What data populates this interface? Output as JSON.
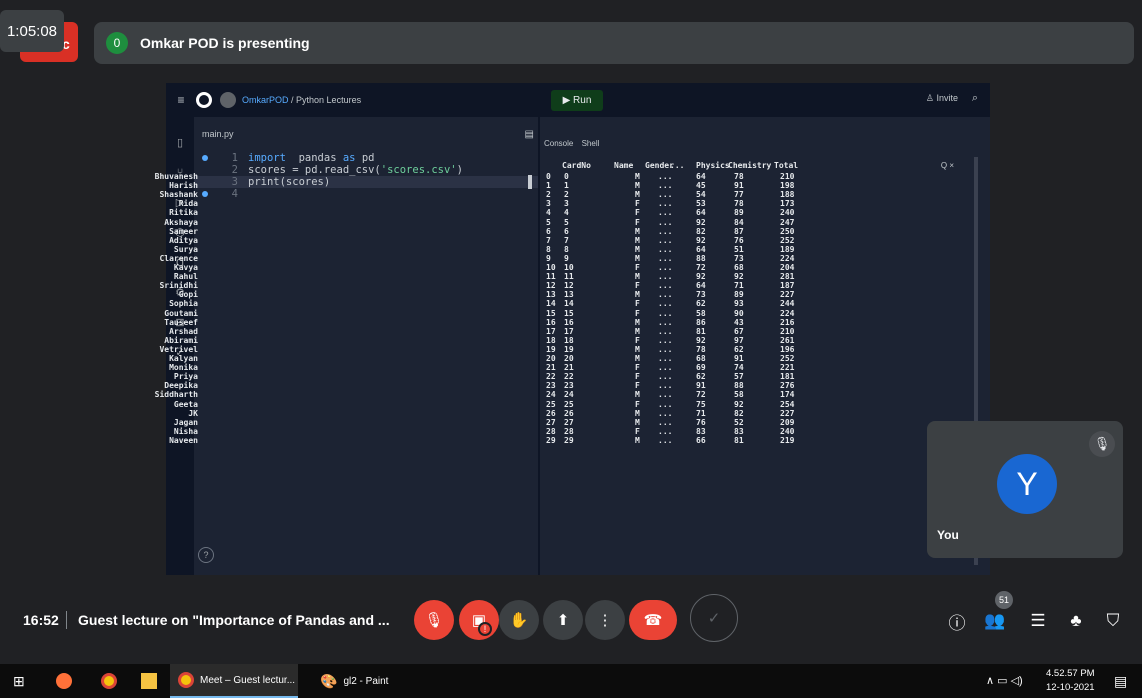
{
  "meeting": {
    "elapsed_timer": "1:05:08",
    "presenter_badge": "0",
    "presenter_text": "Omkar POD is presenting",
    "clock": "16:52",
    "title": "Guest lecture on \"Importance of Pandas and ...",
    "participant_count": "51",
    "self_name": "You",
    "self_initial": "Y"
  },
  "ide": {
    "user": "OmkarPOD",
    "project": "/ Python Lectures",
    "run_label": "Run",
    "invite_label": "Invite",
    "file_tab": "main.py",
    "console_tab": "Console",
    "shell_tab": "Shell",
    "console_tools": "Q ×",
    "help_label": "?",
    "code": [
      {
        "n": "1",
        "parts": [
          [
            "kw",
            "import"
          ],
          [
            "",
            "  pandas "
          ],
          [
            "kw",
            "as"
          ],
          [
            "",
            " pd"
          ]
        ]
      },
      {
        "n": "2",
        "parts": [
          [
            "",
            "scores = pd.read_csv("
          ],
          [
            "str",
            "'scores.csv'"
          ],
          [
            "",
            ")"
          ]
        ]
      },
      {
        "n": "3",
        "parts": [
          [
            "",
            "print(scores)"
          ]
        ]
      },
      {
        "n": "4",
        "parts": []
      }
    ],
    "console_header": [
      "CardNo",
      "Name",
      "Gender",
      "...",
      "Physics",
      "Chemistry",
      "Total"
    ],
    "console_rows": [
      [
        "0",
        "0",
        "Bhuvanesh",
        "M",
        "...",
        "64",
        "78",
        "210"
      ],
      [
        "1",
        "1",
        "Harish",
        "M",
        "...",
        "45",
        "91",
        "198"
      ],
      [
        "2",
        "2",
        "Shashank",
        "M",
        "...",
        "54",
        "77",
        "188"
      ],
      [
        "3",
        "3",
        "Rida",
        "F",
        "...",
        "53",
        "78",
        "173"
      ],
      [
        "4",
        "4",
        "Ritika",
        "F",
        "...",
        "64",
        "89",
        "240"
      ],
      [
        "5",
        "5",
        "Akshaya",
        "F",
        "...",
        "92",
        "84",
        "247"
      ],
      [
        "6",
        "6",
        "Sameer",
        "M",
        "...",
        "82",
        "87",
        "250"
      ],
      [
        "7",
        "7",
        "Aditya",
        "M",
        "...",
        "92",
        "76",
        "252"
      ],
      [
        "8",
        "8",
        "Surya",
        "M",
        "...",
        "64",
        "51",
        "189"
      ],
      [
        "9",
        "9",
        "Clarence",
        "M",
        "...",
        "88",
        "73",
        "224"
      ],
      [
        "10",
        "10",
        "Kavya",
        "F",
        "...",
        "72",
        "68",
        "204"
      ],
      [
        "11",
        "11",
        "Rahul",
        "M",
        "...",
        "92",
        "92",
        "281"
      ],
      [
        "12",
        "12",
        "Srinidhi",
        "F",
        "...",
        "64",
        "71",
        "187"
      ],
      [
        "13",
        "13",
        "Gopi",
        "M",
        "...",
        "73",
        "89",
        "227"
      ],
      [
        "14",
        "14",
        "Sophia",
        "F",
        "...",
        "62",
        "93",
        "244"
      ],
      [
        "15",
        "15",
        "Goutami",
        "F",
        "...",
        "58",
        "90",
        "224"
      ],
      [
        "16",
        "16",
        "Tauseef",
        "M",
        "...",
        "86",
        "43",
        "216"
      ],
      [
        "17",
        "17",
        "Arshad",
        "M",
        "...",
        "81",
        "67",
        "210"
      ],
      [
        "18",
        "18",
        "Abirami",
        "F",
        "...",
        "92",
        "97",
        "261"
      ],
      [
        "19",
        "19",
        "Vetrivel",
        "M",
        "...",
        "78",
        "62",
        "196"
      ],
      [
        "20",
        "20",
        "Kalyan",
        "M",
        "...",
        "68",
        "91",
        "252"
      ],
      [
        "21",
        "21",
        "Monika",
        "F",
        "...",
        "69",
        "74",
        "221"
      ],
      [
        "22",
        "22",
        "Priya",
        "F",
        "...",
        "62",
        "57",
        "181"
      ],
      [
        "23",
        "23",
        "Deepika",
        "F",
        "...",
        "91",
        "88",
        "276"
      ],
      [
        "24",
        "24",
        "Siddharth",
        "M",
        "...",
        "72",
        "58",
        "174"
      ],
      [
        "25",
        "25",
        "Geeta",
        "F",
        "...",
        "75",
        "92",
        "254"
      ],
      [
        "26",
        "26",
        "JK",
        "M",
        "...",
        "71",
        "82",
        "227"
      ],
      [
        "27",
        "27",
        "Jagan",
        "M",
        "...",
        "76",
        "52",
        "209"
      ],
      [
        "28",
        "28",
        "Nisha",
        "F",
        "...",
        "83",
        "83",
        "240"
      ],
      [
        "29",
        "29",
        "Naveen",
        "M",
        "...",
        "66",
        "81",
        "219"
      ]
    ]
  },
  "taskbar": {
    "meet_label": "Meet – Guest lectur...",
    "paint_label": "gl2 - Paint",
    "time": "4.52.57 PM",
    "date": "12-10-2021"
  },
  "colors": {
    "background": "#202124",
    "end_call": "#ea4335",
    "avatar": "#1967d2",
    "run_green": "#0f3d1a"
  }
}
